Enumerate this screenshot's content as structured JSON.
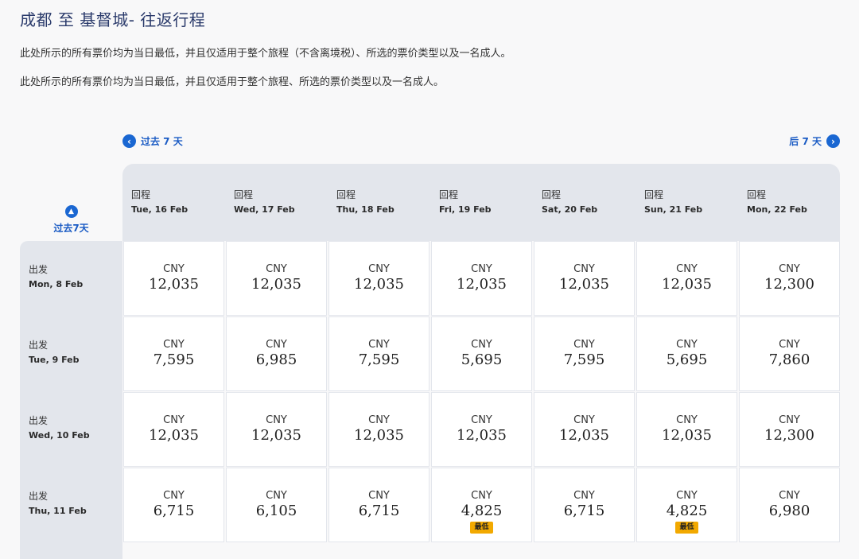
{
  "title": "成都 至 基督城- 往返行程",
  "notes": [
    "此处所示的所有票价均为当日最低，并且仅适用于整个旅程（不含离境税）、所选的票价类型以及一名成人。",
    "此处所示的所有票价均为当日最低，并且仅适用于整个旅程、所选的票价类型以及一名成人。"
  ],
  "nav": {
    "prev_label": "过去 7 天",
    "next_label": "后 7 天",
    "prev_icon": "chevron-left-icon",
    "next_icon": "chevron-right-icon",
    "side_label": "过去7天",
    "side_icon": "chevron-up-icon"
  },
  "return_label": "回程",
  "depart_label": "出发",
  "currency": "CNY",
  "lowest_label": "最低",
  "colors": {
    "accent": "#1a67d2",
    "badge": "#f2a900",
    "band": "#e3e6ec"
  },
  "columns": [
    "Tue, 16 Feb",
    "Wed, 17 Feb",
    "Thu, 18 Feb",
    "Fri, 19 Feb",
    "Sat, 20 Feb",
    "Sun, 21 Feb",
    "Mon, 22 Feb"
  ],
  "rows": [
    {
      "date": "Mon, 8 Feb",
      "prices": [
        "12,035",
        "12,035",
        "12,035",
        "12,035",
        "12,035",
        "12,035",
        "12,300"
      ],
      "lowest": [
        false,
        false,
        false,
        false,
        false,
        false,
        false
      ]
    },
    {
      "date": "Tue, 9 Feb",
      "prices": [
        "7,595",
        "6,985",
        "7,595",
        "5,695",
        "7,595",
        "5,695",
        "7,860"
      ],
      "lowest": [
        false,
        false,
        false,
        false,
        false,
        false,
        false
      ]
    },
    {
      "date": "Wed, 10 Feb",
      "prices": [
        "12,035",
        "12,035",
        "12,035",
        "12,035",
        "12,035",
        "12,035",
        "12,300"
      ],
      "lowest": [
        false,
        false,
        false,
        false,
        false,
        false,
        false
      ]
    },
    {
      "date": "Thu, 11 Feb",
      "prices": [
        "6,715",
        "6,105",
        "6,715",
        "4,825",
        "6,715",
        "4,825",
        "6,980"
      ],
      "lowest": [
        false,
        false,
        false,
        true,
        false,
        true,
        false
      ]
    }
  ]
}
